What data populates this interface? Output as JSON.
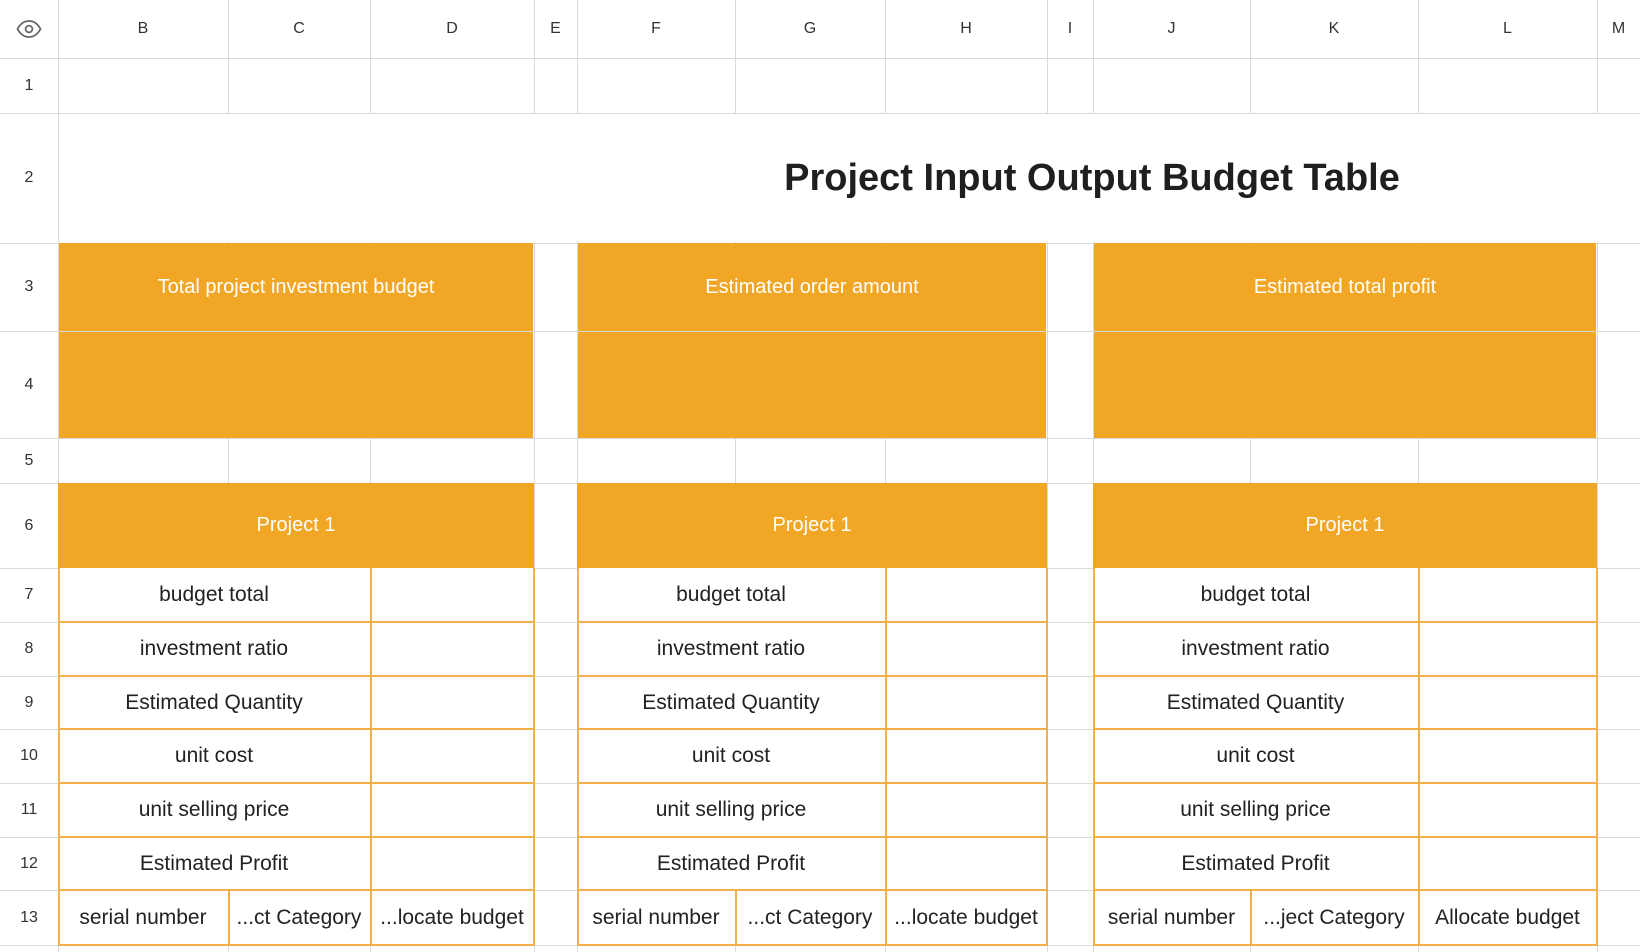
{
  "sheet": {
    "column_headers": [
      "B",
      "C",
      "D",
      "E",
      "F",
      "G",
      "H",
      "I",
      "J",
      "K",
      "L",
      "M"
    ],
    "row_headers": [
      "1",
      "2",
      "3",
      "4",
      "5",
      "6",
      "7",
      "8",
      "9",
      "10",
      "11",
      "12",
      "13"
    ],
    "title": "Project Input Output Budget Table",
    "summary_labels": [
      "Total project investment budget",
      "Estimated order amount",
      "Estimated total profit"
    ],
    "project_labels": [
      "Project 1",
      "Project 1",
      "Project 1"
    ],
    "row_labels": [
      "budget total",
      "investment ratio",
      "Estimated Quantity",
      "unit cost",
      "unit selling price",
      "Estimated Profit"
    ],
    "row13": [
      [
        "serial number",
        "...ct Category",
        "...locate budget"
      ],
      [
        "serial number",
        "...ct Category",
        "...locate budget"
      ],
      [
        "serial number",
        "...ject Category",
        "Allocate budget"
      ]
    ]
  },
  "icons": {
    "visibility": "eye-icon"
  }
}
